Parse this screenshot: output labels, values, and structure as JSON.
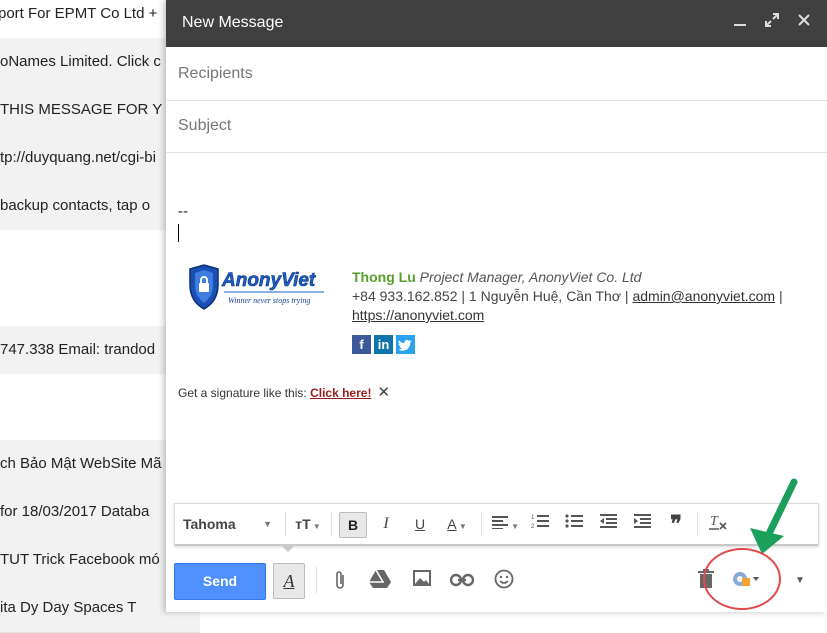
{
  "background_list": {
    "rows": [
      "port For EPMT Co Ltd +",
      "oNames Limited. Click c",
      "THIS MESSAGE FOR Y",
      "tp://duyquang.net/cgi-bi",
      "backup contacts, tap o",
      "",
      "747.338 Email: trandod",
      "",
      "ch Bảo Mật WebSite Mã",
      "for 18/03/2017 Databa",
      "TUT Trick Facebook mó",
      "ita Dy Day Spaces T"
    ]
  },
  "compose": {
    "title": "New Message",
    "window_icons": [
      "minimize-icon",
      "expand-icon",
      "close-icon"
    ],
    "recipients_placeholder": "Recipients",
    "subject_placeholder": "Subject",
    "body_dashes": "--",
    "signature": {
      "logo_text": "AnonyViet",
      "logo_tagline": "Winner never stops trying",
      "name": "Thong Lu",
      "role": "Project Manager, AnonyViet Co. Ltd",
      "phone_address": "+84 933.162.852 | 1 Nguyễn Huệ, Cần Thơ | ",
      "email": "admin@anonyviet.com",
      "email_suffix": " |",
      "website": "https://anonyviet.com",
      "socials": [
        "f",
        "in",
        "t"
      ]
    },
    "promo": {
      "text": "Get a signature like this: ",
      "link": "Click here!",
      "close": "✕"
    },
    "format_toolbar": {
      "font": "Tahoma",
      "items": [
        "size-icon",
        "bold-icon",
        "italic-icon",
        "underline-icon",
        "text-color-icon",
        "align-icon",
        "numbered-list-icon",
        "bulleted-list-icon",
        "indent-less-icon",
        "indent-more-icon",
        "quote-icon",
        "remove-formatting-icon"
      ]
    },
    "send_label": "Send",
    "bottom_icons": [
      "formatting-icon",
      "attach-icon",
      "drive-icon",
      "photo-icon",
      "link-icon",
      "emoji-icon",
      "trash-icon",
      "extension-icon",
      "more-options-icon"
    ]
  },
  "colors": {
    "titlebar": "#404040",
    "send": "#4d90fe",
    "signature_name": "#5a9e2a",
    "annotation_circle": "#e24a4a",
    "annotation_arrow": "#1aa05a"
  }
}
